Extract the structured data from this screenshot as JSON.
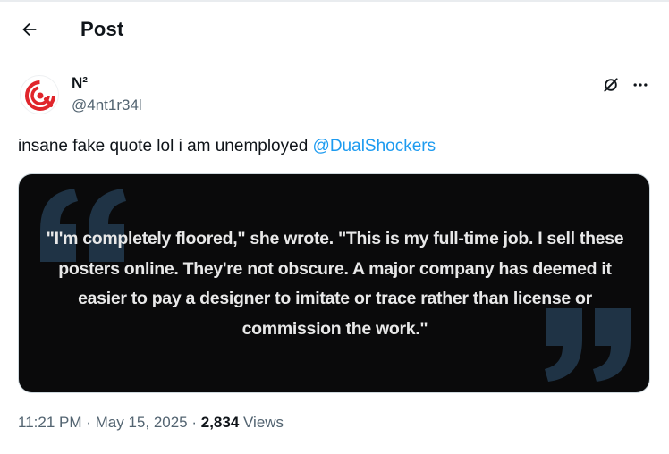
{
  "header": {
    "back_icon": "arrow-left-icon",
    "title": "Post"
  },
  "author": {
    "name": "N²",
    "handle": "@4nt1r34l",
    "avatar_icon": "red-swirl-logo-icon",
    "accent": "#e0252b"
  },
  "actions": {
    "grok_icon": "grok-slash-icon",
    "more_icon": "ellipsis-icon"
  },
  "tweet": {
    "text": "insane fake quote lol i am unemployed ",
    "mention": "@DualShockers"
  },
  "media": {
    "quote_text": "\"I'm completely floored,\" she wrote. \"This is my full-time job. I sell these posters online. They're not obscure. A major company has deemed it easier to pay a designer to imitate or trace rather than license or commission the work.\"",
    "quote_mark_color": "#1f3345",
    "background": "#0a0a0b"
  },
  "meta": {
    "time": "11:21 PM",
    "sep1": " · ",
    "date": "May 15, 2025",
    "sep2": " · ",
    "view_count": "2,834",
    "views_label": " Views"
  },
  "colors": {
    "text": "#0f1419",
    "secondary": "#536471",
    "link": "#1d9bf0"
  }
}
